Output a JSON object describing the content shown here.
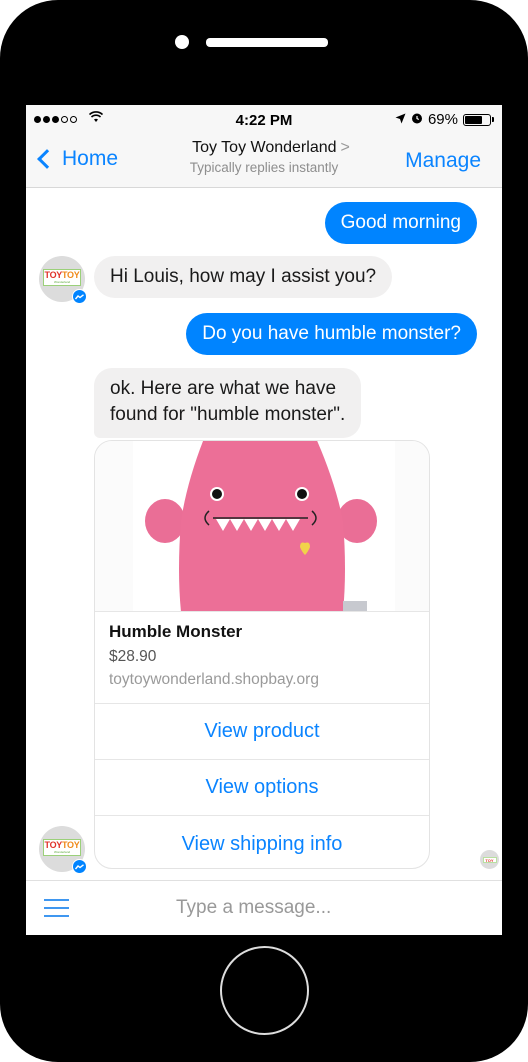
{
  "device": {
    "home_button": "home-button"
  },
  "status_bar": {
    "signal_dots_filled": 3,
    "signal_dots_total": 5,
    "wifi_icon": "wifi-icon",
    "time": "4:22 PM",
    "location_icon": "➚",
    "alarm_icon": "⏰",
    "battery_percent": "69%",
    "battery_level": 0.69
  },
  "nav": {
    "back_label": "Home",
    "title": "Toy Toy Wonderland",
    "title_chevron": ">",
    "subtitle": "Typically replies instantly",
    "manage_label": "Manage"
  },
  "colors": {
    "accent": "#0a84ff",
    "outgoing_bubble": "#0084ff",
    "incoming_bubble": "#f1f0f0"
  },
  "avatar": {
    "logo_top": [
      "TOY",
      "TOY"
    ],
    "logo_sub": "Wonderland",
    "badge_icon": "messenger-icon",
    "badge_glyph": "~"
  },
  "messages": [
    {
      "direction": "outgoing",
      "text": "Good morning"
    },
    {
      "direction": "incoming",
      "text": "Hi Louis, how may I assist you?"
    },
    {
      "direction": "outgoing",
      "text": "Do you have humble monster?"
    },
    {
      "direction": "incoming",
      "lines": [
        "ok.  Here are what we have",
        "found for \"humble monster\"."
      ]
    }
  ],
  "product_card": {
    "image_alt": "Pink plush Humble Monster toy",
    "title": "Humble Monster",
    "price": "$28.90",
    "url": "toytoywonderland.shopbay.org",
    "buttons": [
      "View product",
      "View options",
      "View shipping info"
    ]
  },
  "composer": {
    "menu_icon": "hamburger-menu-icon",
    "placeholder": "Type a message...",
    "value": ""
  }
}
